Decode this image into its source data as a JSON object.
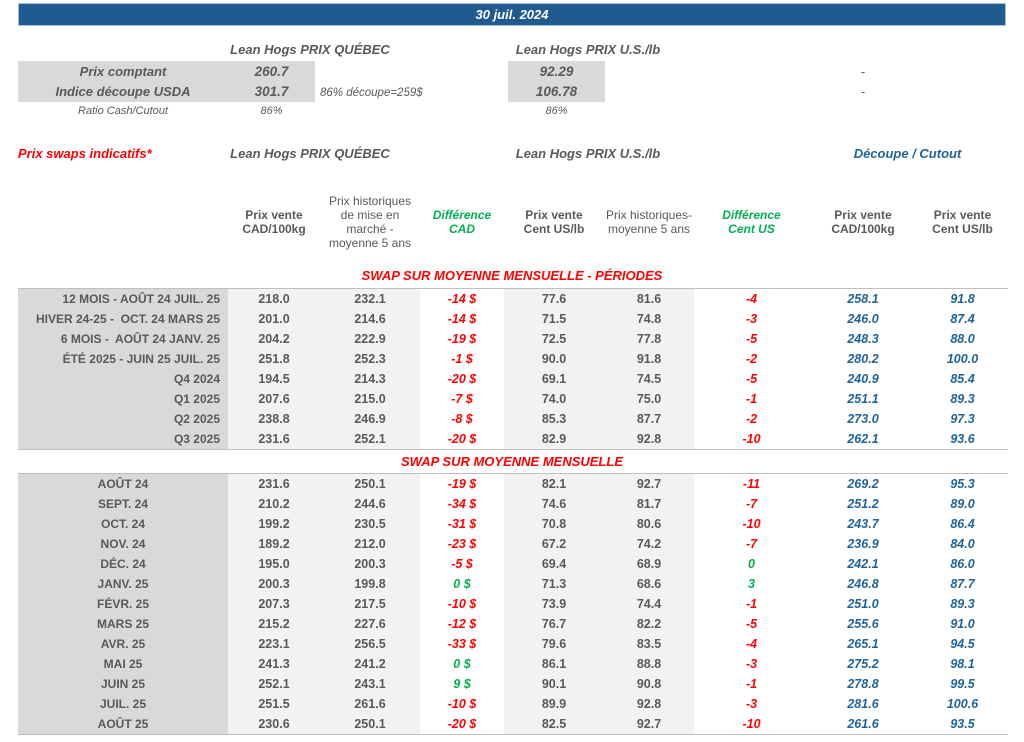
{
  "titlebar": {
    "date": "30 juil. 2024"
  },
  "colors": {
    "accent_blue": "#1F5B8E",
    "text_gray": "#595959",
    "negative_red": "#FF0000",
    "positive_green": "#00B050",
    "cutout_blue": "#1F6398",
    "label_bg": "#D9D9D9",
    "band_bg": "#F2F2F2"
  },
  "spot": {
    "qc_header": "Lean Hogs PRIX QUÉBEC",
    "us_header": "Lean Hogs PRIX U.S./lb",
    "comptant": {
      "label": "Prix comptant",
      "qc": "260.7",
      "us": "92.29",
      "cutout": "-"
    },
    "indice": {
      "label": "Indice découpe USDA",
      "qc": "301.7",
      "us": "106.78",
      "note": "86% découpe=259$",
      "cutout": "-"
    },
    "ratio": {
      "label": "Ratio Cash/Cutout",
      "qc": "86%",
      "us": "86%"
    }
  },
  "swaps": {
    "title": "Prix swaps indicatifs*",
    "qc_header": "Lean Hogs PRIX QUÉBEC",
    "us_header": "Lean Hogs PRIX U.S./lb",
    "cutout_header": "Découpe / Cutout",
    "columns": {
      "h1": "Prix vente\nCAD/100kg",
      "h2": "Prix historiques\nde mise en\nmarché -\nmoyenne 5 ans",
      "h3": "Différence\nCAD",
      "h4": "Prix vente\nCent US/lb",
      "h5": "Prix historiques-\nmoyenne 5 ans",
      "h6": "Différence\nCent US",
      "h7": "Prix vente\nCAD/100kg",
      "h8": "Prix vente\nCent US/lb"
    },
    "section_periods": {
      "title": "SWAP SUR MOYENNE MENSUELLE - PÉRIODES",
      "rows": [
        [
          "12 MOIS - AOÛT 24 JUIL. 25",
          "218.0",
          "232.1",
          "-14 $",
          "77.6",
          "81.6",
          "-4",
          "258.1",
          "91.8"
        ],
        [
          "HIVER 24-25 -  OCT. 24 MARS 25",
          "201.0",
          "214.6",
          "-14 $",
          "71.5",
          "74.8",
          "-3",
          "246.0",
          "87.4"
        ],
        [
          "6 MOIS -  AOÛT 24 JANV. 25",
          "204.2",
          "222.9",
          "-19 $",
          "72.5",
          "77.8",
          "-5",
          "248.3",
          "88.0"
        ],
        [
          "ÉTÉ 2025 - JUIN 25 JUIL. 25",
          "251.8",
          "252.3",
          "-1 $",
          "90.0",
          "91.8",
          "-2",
          "280.2",
          "100.0"
        ],
        [
          "Q4 2024",
          "194.5",
          "214.3",
          "-20 $",
          "69.1",
          "74.5",
          "-5",
          "240.9",
          "85.4"
        ],
        [
          "Q1 2025",
          "207.6",
          "215.0",
          "-7 $",
          "74.0",
          "75.0",
          "-1",
          "251.1",
          "89.3"
        ],
        [
          "Q2 2025",
          "238.8",
          "246.9",
          "-8 $",
          "85.3",
          "87.7",
          "-2",
          "273.0",
          "97.3"
        ],
        [
          "Q3 2025",
          "231.6",
          "252.1",
          "-20 $",
          "82.9",
          "92.8",
          "-10",
          "262.1",
          "93.6"
        ]
      ]
    },
    "section_monthly": {
      "title": "SWAP SUR MOYENNE MENSUELLE",
      "rows": [
        [
          "AOÛT 24",
          "231.6",
          "250.1",
          "-19 $",
          "82.1",
          "92.7",
          "-11",
          "269.2",
          "95.3"
        ],
        [
          "SEPT. 24",
          "210.2",
          "244.6",
          "-34 $",
          "74.6",
          "81.7",
          "-7",
          "251.2",
          "89.0"
        ],
        [
          "OCT. 24",
          "199.2",
          "230.5",
          "-31 $",
          "70.8",
          "80.6",
          "-10",
          "243.7",
          "86.4"
        ],
        [
          "NOV. 24",
          "189.2",
          "212.0",
          "-23 $",
          "67.2",
          "74.2",
          "-7",
          "236.9",
          "84.0"
        ],
        [
          "DÉC. 24",
          "195.0",
          "200.3",
          "-5 $",
          "69.4",
          "68.9",
          "0",
          "242.1",
          "86.0"
        ],
        [
          "JANV. 25",
          "200.3",
          "199.8",
          "0 $",
          "71.3",
          "68.6",
          "3",
          "246.8",
          "87.7"
        ],
        [
          "FÉVR. 25",
          "207.3",
          "217.5",
          "-10 $",
          "73.9",
          "74.4",
          "-1",
          "251.0",
          "89.3"
        ],
        [
          "MARS 25",
          "215.2",
          "227.6",
          "-12 $",
          "76.7",
          "82.2",
          "-5",
          "255.6",
          "91.0"
        ],
        [
          "AVR. 25",
          "223.1",
          "256.5",
          "-33 $",
          "79.6",
          "83.5",
          "-4",
          "265.1",
          "94.5"
        ],
        [
          "MAI 25",
          "241.3",
          "241.2",
          "0 $",
          "86.1",
          "88.8",
          "-3",
          "275.2",
          "98.1"
        ],
        [
          "JUIN 25",
          "252.1",
          "243.1",
          "9 $",
          "90.1",
          "90.8",
          "-1",
          "278.8",
          "99.5"
        ],
        [
          "JUIL. 25",
          "251.5",
          "261.6",
          "-10 $",
          "89.9",
          "92.8",
          "-3",
          "281.6",
          "100.6"
        ],
        [
          "AOÛT 25",
          "230.6",
          "250.1",
          "-20 $",
          "82.5",
          "92.7",
          "-10",
          "261.6",
          "93.5"
        ]
      ]
    }
  }
}
